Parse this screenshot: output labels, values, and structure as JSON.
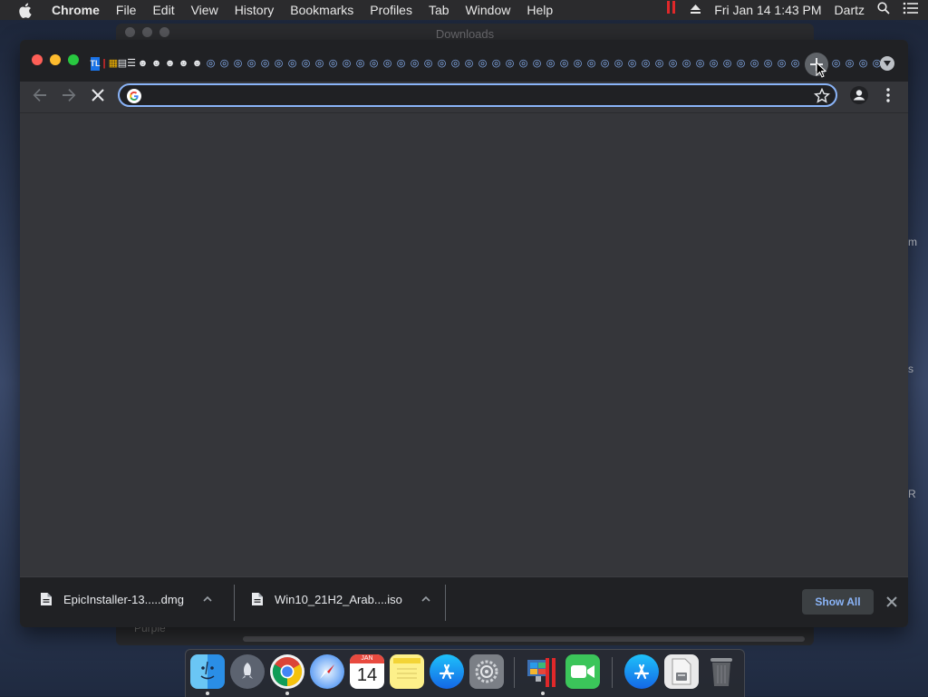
{
  "menubar": {
    "app_name": "Chrome",
    "items": [
      "File",
      "Edit",
      "View",
      "History",
      "Bookmarks",
      "Profiles",
      "Tab",
      "Window",
      "Help"
    ],
    "datetime": "Fri Jan 14  1:43 PM",
    "user": "Dartz"
  },
  "background": {
    "finder_title": "Downloads",
    "finder_sidebar_item": "Purple",
    "right_strip_letters": [
      "m",
      "s",
      "R"
    ]
  },
  "chrome": {
    "tab_favicons": [
      "TL",
      "|",
      "▦",
      "▤",
      "☰",
      "☻",
      "☻",
      "☻",
      "☻",
      "☻",
      "◎",
      "◎",
      "◎",
      "◎",
      "◎",
      "◎",
      "◎",
      "◎",
      "◎",
      "◎",
      "◎",
      "◎",
      "◎",
      "◎",
      "◎",
      "◎",
      "◎",
      "◎",
      "◎",
      "◎",
      "◎",
      "◎",
      "◎",
      "◎",
      "◎",
      "◎",
      "◎",
      "◎",
      "◎",
      "◎",
      "◎",
      "◎",
      "◎",
      "◎",
      "◎",
      "◎",
      "◎",
      "◎",
      "◎",
      "◎",
      "◎",
      "◎",
      "◎",
      "◎",
      "◎",
      "◎",
      "◎",
      "◎",
      "◎",
      "◎"
    ],
    "omnibox": {
      "value": "",
      "placeholder": ""
    },
    "accent": "#8ab4f8",
    "downloads": [
      {
        "name": "EpicInstaller-13.....dmg"
      },
      {
        "name": "Win10_21H2_Arab....iso"
      }
    ],
    "show_all_label": "Show All"
  },
  "dock": {
    "apps": [
      "finder-icon",
      "launchpad-icon",
      "chrome-icon",
      "safari-icon",
      "calendar-icon",
      "notes-icon",
      "app-store-icon",
      "system-preferences-icon",
      "parallels-icon",
      "facetime-icon",
      "app-store-download-icon",
      "disk-image-icon",
      "trash-icon"
    ],
    "calendar_month": "JAN",
    "calendar_day": "14"
  }
}
